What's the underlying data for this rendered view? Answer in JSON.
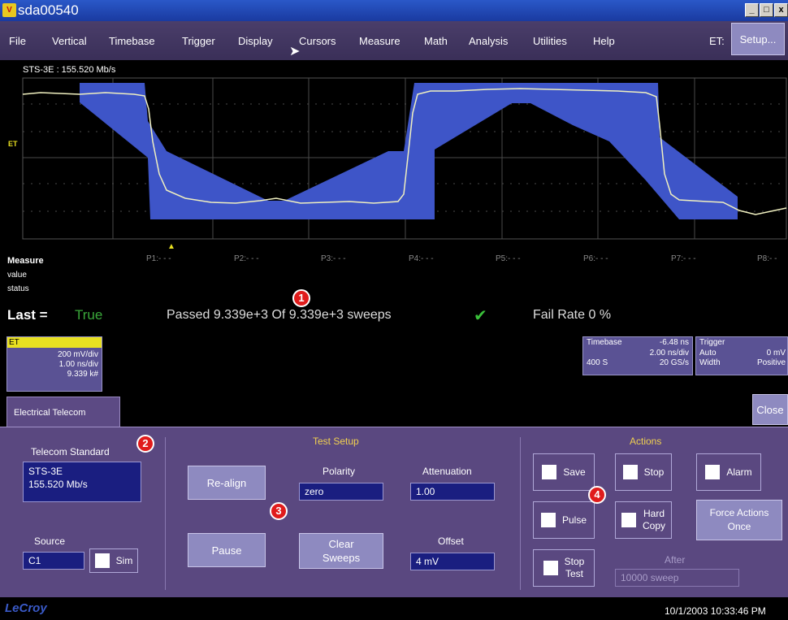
{
  "window": {
    "title": "sda00540",
    "icon": "lecroy-app-icon"
  },
  "menu": {
    "items": [
      "File",
      "Vertical",
      "Timebase",
      "Trigger",
      "Display",
      "Cursors",
      "Measure",
      "Math",
      "Analysis",
      "Utilities",
      "Help"
    ],
    "et_label": "ET:",
    "setup_label": "Setup..."
  },
  "scope": {
    "trace_label": "STS-3E : 155.520 Mb/s",
    "channel_marker": "ET",
    "param_labels": [
      "P1:- - -",
      "P2:- - -",
      "P3:- - -",
      "P4:- - -",
      "P5:- - -",
      "P6:- - -",
      "P7:- - -",
      "P8:- -"
    ]
  },
  "measure": {
    "heading": "Measure",
    "value_label": "value",
    "status_label": "status",
    "last_label": "Last =",
    "last_value": "True",
    "passed_text": "Passed 9.339e+3  Of 9.339e+3  sweeps",
    "fail_rate_text": "Fail Rate  0 %"
  },
  "et_descriptor": {
    "name": "ET",
    "volts_div": "200 mV/div",
    "time_div": "1.00 ns/div",
    "count": "9.339 k#"
  },
  "timebase": {
    "label": "Timebase",
    "delay": "-6.48 ns",
    "time_div": "2.00 ns/div",
    "samples": "400 S",
    "rate": "20 GS/s"
  },
  "trigger": {
    "label": "Trigger",
    "mode": "Auto",
    "level": "0 mV",
    "type": "Width",
    "slope": "Positive"
  },
  "dialog": {
    "tab_label": "Electrical Telecom",
    "close_label": "Close",
    "telecom_standard_label": "Telecom Standard",
    "telecom_standard_value_line1": "STS-3E",
    "telecom_standard_value_line2": "155.520 Mb/s",
    "source_label": "Source",
    "source_value": "C1",
    "sim_label": "Sim",
    "test_setup_title": "Test Setup",
    "realign_label": "Re-align",
    "pause_label": "Pause",
    "polarity_label": "Polarity",
    "polarity_value": "zero",
    "clear_line1": "Clear",
    "clear_line2": "Sweeps",
    "attenuation_label": "Attenuation",
    "attenuation_value": "1.00",
    "offset_label": "Offset",
    "offset_value": "4 mV",
    "actions_title": "Actions",
    "save_label": "Save",
    "stop_label": "Stop",
    "alarm_label": "Alarm",
    "pulse_label": "Pulse",
    "hardcopy_line1": "Hard",
    "hardcopy_line2": "Copy",
    "force_line1": "Force Actions",
    "force_line2": "Once",
    "stoptest_line1": "Stop",
    "stoptest_line2": "Test",
    "after_label": "After",
    "after_value": "10000 sweep"
  },
  "badges": [
    "1",
    "2",
    "3",
    "4"
  ],
  "footer": {
    "logo": "LeCroy",
    "datetime": "10/1/2003 10:33:46 PM"
  },
  "colors": {
    "mask": "#3e55c8",
    "trace": "#e8e8b0",
    "panel": "#5a4880",
    "pass": "#3aa83a",
    "badge": "#e01c1c"
  }
}
